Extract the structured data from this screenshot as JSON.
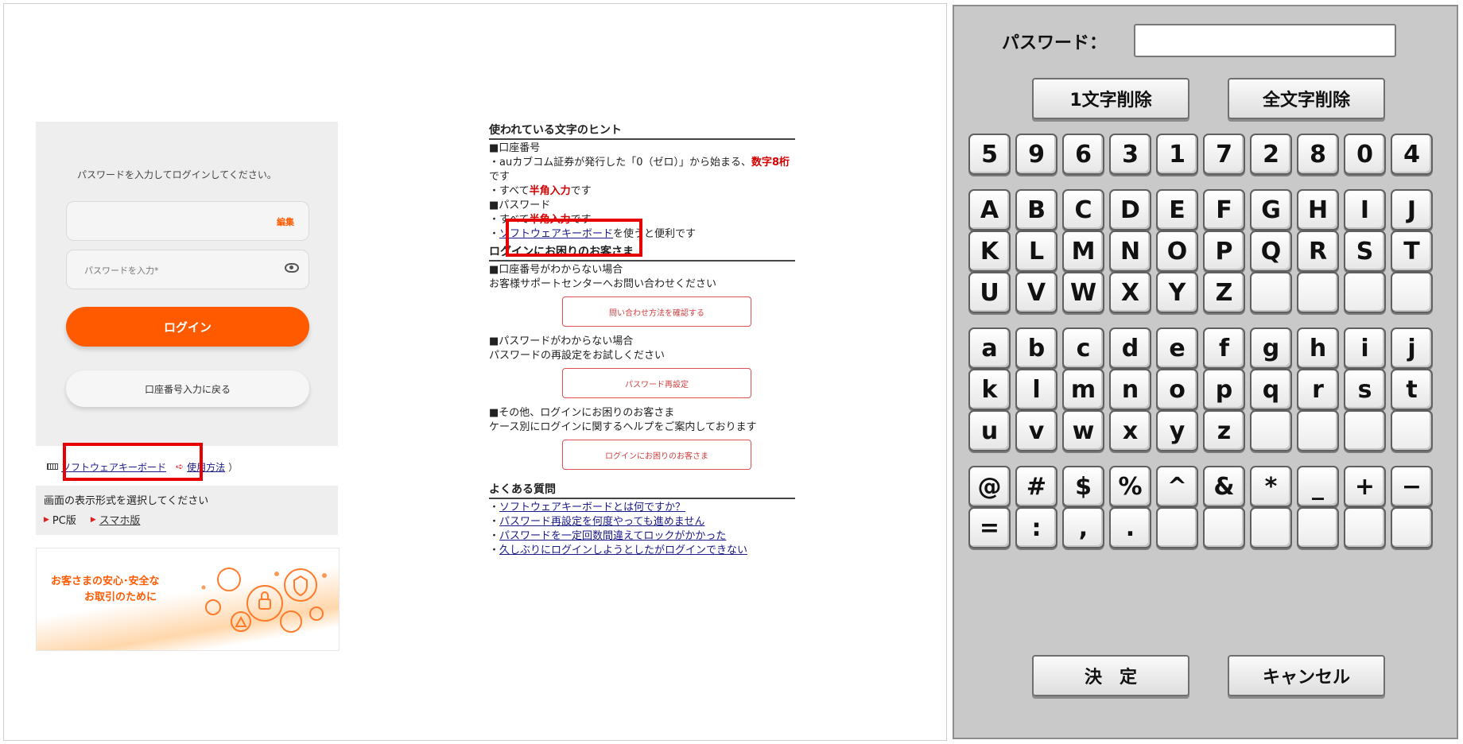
{
  "login": {
    "instruction": "パスワードを入力してログインしてください。",
    "edit_label": "編集",
    "password_placeholder": "パスワードを入力*",
    "login_button": "ログイン",
    "back_button": "口座番号入力に戻る",
    "software_keyboard_link": "ソフトウェアキーボード",
    "usage_link": "使用方法",
    "usage_paren": "）",
    "display_prompt": "画面の表示形式を選択してください",
    "pc_label": "PC版",
    "smartphone_label": "スマホ版",
    "banner_line1": "お客さまの安心･安全な",
    "banner_line2": "お取引のために"
  },
  "hints": {
    "title": "使われている文字のヒント",
    "account_heading": "■口座番号",
    "account_line1_pre": "・auカブコム証券が発行した「0（ゼロ）」から始まる、",
    "account_line1_red": "数字8桁",
    "account_line1_post": "です",
    "account_line2_pre": "・すべて",
    "account_line2_red": "半角入力",
    "account_line2_post": "です",
    "password_heading": "■パスワード",
    "password_line1_pre": "・すべて",
    "password_line1_red": "半角入力",
    "password_line1_post": "です",
    "password_line2_pre": "・",
    "password_line2_link": "ソフトウェアキーボード",
    "password_line2_post": "を使うと便利です"
  },
  "trouble": {
    "title": "ログインにお困りのお客さま",
    "account_heading": "■口座番号がわからない場合",
    "account_text": "お客様サポートセンターへお問い合わせください",
    "account_button": "問い合わせ方法を確認する",
    "password_heading": "■パスワードがわからない場合",
    "password_text": "パスワードの再設定をお試しください",
    "password_button": "パスワード再設定",
    "other_heading": "■その他、ログインにお困りのお客さま",
    "other_text": "ケース別にログインに関するヘルプをご案内しております",
    "other_button": "ログインにお困りのお客さま"
  },
  "faq": {
    "title": "よくある質問",
    "items": [
      "ソフトウェアキーボードとは何ですか？",
      "パスワード再設定を何度やっても進めません",
      "パスワードを一定回数間違えてロックがかかった",
      "久しぶりにログインしようとしたがログインできない"
    ]
  },
  "keyboard": {
    "password_label": "パスワード：",
    "password_value": "",
    "delete_one": "1文字削除",
    "delete_all": "全文字削除",
    "rows": [
      [
        "5",
        "9",
        "6",
        "3",
        "1",
        "7",
        "2",
        "8",
        "0",
        "4"
      ],
      [
        "A",
        "B",
        "C",
        "D",
        "E",
        "F",
        "G",
        "H",
        "I",
        "J"
      ],
      [
        "K",
        "L",
        "M",
        "N",
        "O",
        "P",
        "Q",
        "R",
        "S",
        "T"
      ],
      [
        "U",
        "V",
        "W",
        "X",
        "Y",
        "Z",
        "",
        "",
        "",
        ""
      ],
      [
        "a",
        "b",
        "c",
        "d",
        "e",
        "f",
        "g",
        "h",
        "i",
        "j"
      ],
      [
        "k",
        "l",
        "m",
        "n",
        "o",
        "p",
        "q",
        "r",
        "s",
        "t"
      ],
      [
        "u",
        "v",
        "w",
        "x",
        "y",
        "z",
        "",
        "",
        "",
        ""
      ],
      [
        "@",
        "#",
        "$",
        "%",
        "^",
        "&",
        "*",
        "_",
        "+",
        "−"
      ],
      [
        "=",
        ":",
        ",",
        ".",
        "",
        "",
        "",
        "",
        "",
        ""
      ]
    ],
    "confirm": "決　定",
    "cancel": "キャンセル"
  },
  "colors": {
    "accent": "#ff5a00",
    "highlight": "#e60000",
    "keyboard_bg": "#c9c9c9"
  }
}
